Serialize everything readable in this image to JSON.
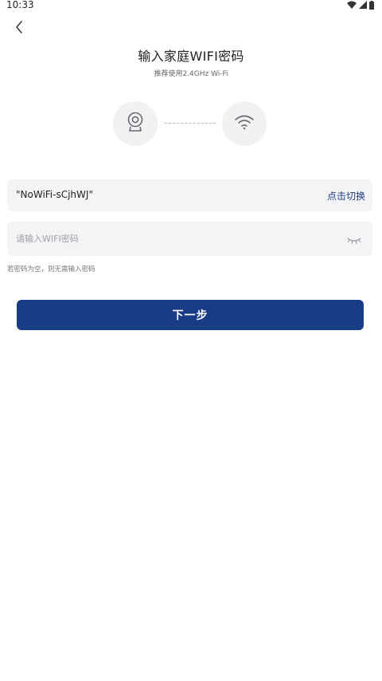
{
  "status_bar": {
    "time": "10:33",
    "icons": [
      "wifi-icon",
      "cellular-signal-icon",
      "battery-icon"
    ]
  },
  "header": {
    "back_icon": "chevron-left-icon",
    "title": "输入家庭WIFI密码",
    "subtitle": "推荐使用2.4GHz Wi-Fi"
  },
  "illustration": {
    "left_icon": "camera-icon",
    "right_icon": "wifi-icon"
  },
  "network": {
    "ssid": "\"NoWiFi-sCjhWJ\"",
    "switch_label": "点击切换"
  },
  "password": {
    "value": "",
    "placeholder": "请输入WIFI密码",
    "visibility_icon": "eye-closed-icon",
    "hint": "若密码为空，则无需输入密码"
  },
  "actions": {
    "next_label": "下一步"
  },
  "colors": {
    "accent": "#193c85",
    "link": "#1f3f84",
    "field_bg": "#f4f4f6",
    "circle_bg": "#f1f1f3"
  }
}
